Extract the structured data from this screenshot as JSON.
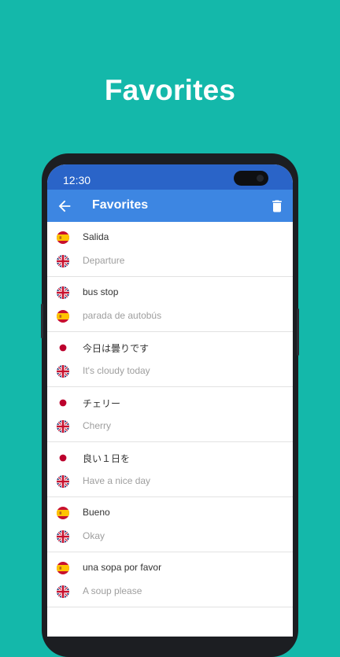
{
  "promo": {
    "title": "Favorites"
  },
  "status_bar": {
    "time": "12:30"
  },
  "app_bar": {
    "title": "Favorites",
    "back_icon": "arrow-left-icon",
    "delete_icon": "trash-icon"
  },
  "colors": {
    "background": "#14b8aa",
    "status_bar": "#2a64c8",
    "app_bar": "#3d86e2"
  },
  "favorites": [
    {
      "source_flag": "es",
      "source": "Salida",
      "target_flag": "gb",
      "target": "Departure"
    },
    {
      "source_flag": "gb",
      "source": "bus stop",
      "target_flag": "es",
      "target": "parada de autobús"
    },
    {
      "source_flag": "jp",
      "source": "今日は曇りです",
      "target_flag": "gb",
      "target": "It's cloudy today"
    },
    {
      "source_flag": "jp",
      "source": "チェリー",
      "target_flag": "gb",
      "target": "Cherry"
    },
    {
      "source_flag": "jp",
      "source": "良い１日を",
      "target_flag": "gb",
      "target": "Have a nice day"
    },
    {
      "source_flag": "es",
      "source": "Bueno",
      "target_flag": "gb",
      "target": "Okay"
    },
    {
      "source_flag": "es",
      "source": "una sopa por favor",
      "target_flag": "gb",
      "target": "A soup please"
    }
  ]
}
